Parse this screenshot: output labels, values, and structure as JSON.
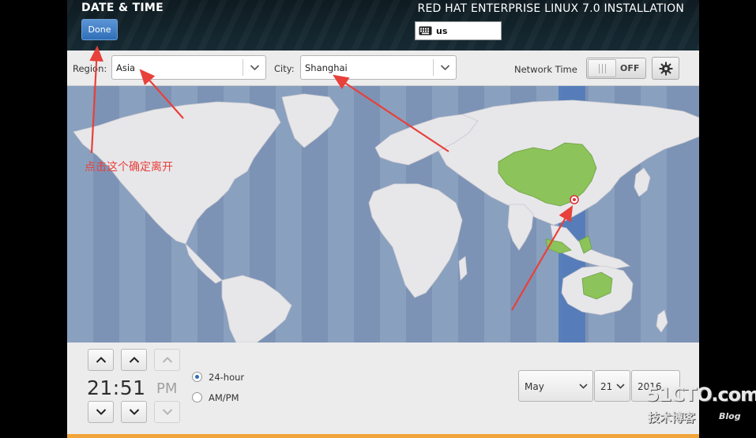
{
  "header": {
    "screen_title": "DATE & TIME",
    "done_label": "Done",
    "product_title": "RED HAT ENTERPRISE LINUX 7.0 INSTALLATION",
    "keyboard_layout": "us",
    "keyboard_icon": "keyboard-icon"
  },
  "toolbar": {
    "region_label": "Region:",
    "region_value": "Asia",
    "city_label": "City:",
    "city_value": "Shanghai",
    "network_time_label": "Network Time",
    "network_time_state": "OFF",
    "settings_icon": "gear-icon"
  },
  "map": {
    "selected_city": "Shanghai",
    "highlight_color": "#8cc35a",
    "ocean_color": "#7f95b6",
    "land_color": "#e6e6e8",
    "marker_color": "#e0303a"
  },
  "time": {
    "hours_minutes": "21:51",
    "ampm": "PM",
    "format_24h_label": "24-hour",
    "format_ampm_label": "AM/PM",
    "selected_format": "24-hour"
  },
  "date": {
    "month": "May",
    "day": "21",
    "year": "2016"
  },
  "annotation": {
    "text": "点击这个确定离开",
    "color": "#e8403a"
  },
  "watermark": {
    "main": "51CTO.com",
    "sub": "技术博客",
    "blog": "Blog"
  }
}
